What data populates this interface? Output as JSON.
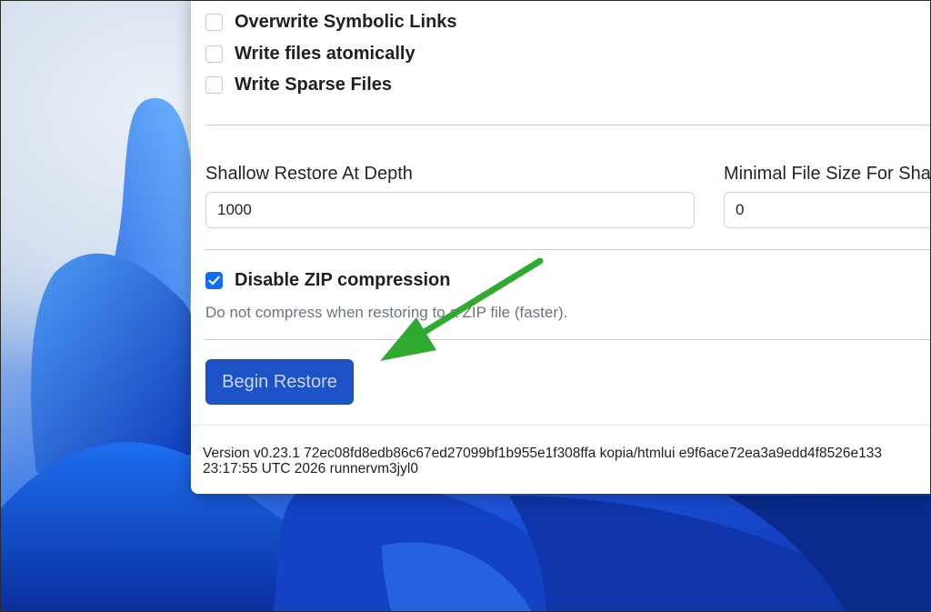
{
  "options": {
    "overwrite_symlinks": {
      "label": "Overwrite Symbolic Links",
      "checked": false
    },
    "write_atomically": {
      "label": "Write files atomically",
      "checked": false
    },
    "write_sparse": {
      "label": "Write Sparse Files",
      "checked": false
    }
  },
  "shallow_restore": {
    "label": "Shallow Restore At Depth",
    "value": "1000"
  },
  "min_file_size": {
    "label": "Minimal File Size For Sha",
    "value": "0"
  },
  "zip": {
    "label": "Disable ZIP compression",
    "checked": true,
    "help": "Do not compress when restoring to a ZIP file (faster)."
  },
  "begin_button": {
    "label": "Begin Restore"
  },
  "version": {
    "line1": "Version v0.23.1 72ec08fd8edb86c67ed27099bf1b955e1f308ffa kopia/htmlui e9f6ace72ea3a9edd4f8526e133",
    "line2": "23:17:55 UTC 2026 runnervm3jyl0"
  },
  "annotation": {
    "arrow_color": "#2eaa2e"
  }
}
